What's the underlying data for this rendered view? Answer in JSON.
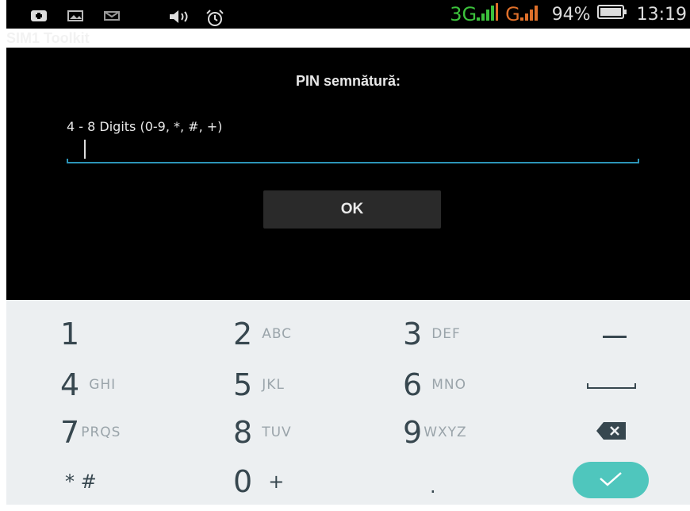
{
  "status_bar": {
    "network_3g": "3G",
    "network_g": "G",
    "battery_percent": "94%",
    "time": "13:19",
    "colors": {
      "green": "#3cc23c",
      "orange": "#e0702a"
    }
  },
  "app": {
    "title": "SIM1 Toolkit"
  },
  "dialog": {
    "title": "PIN semnătură:",
    "hint": "4 - 8 Digits (0-9, *, #, +)",
    "pin_value": "",
    "ok_label": "OK"
  },
  "keypad": {
    "keys": [
      {
        "num": "1",
        "letters": ""
      },
      {
        "num": "2",
        "letters": "ABC"
      },
      {
        "num": "3",
        "letters": "DEF"
      },
      {
        "num": "4",
        "letters": "GHI"
      },
      {
        "num": "5",
        "letters": "JKL"
      },
      {
        "num": "6",
        "letters": "MNO"
      },
      {
        "num": "7",
        "letters": "PRQS"
      },
      {
        "num": "8",
        "letters": "TUV"
      },
      {
        "num": "9",
        "letters": "WXYZ"
      },
      {
        "num": "0",
        "letters": "+"
      }
    ],
    "star_hash": "* #",
    "dot": ".",
    "accent": "#4fc6bd"
  }
}
